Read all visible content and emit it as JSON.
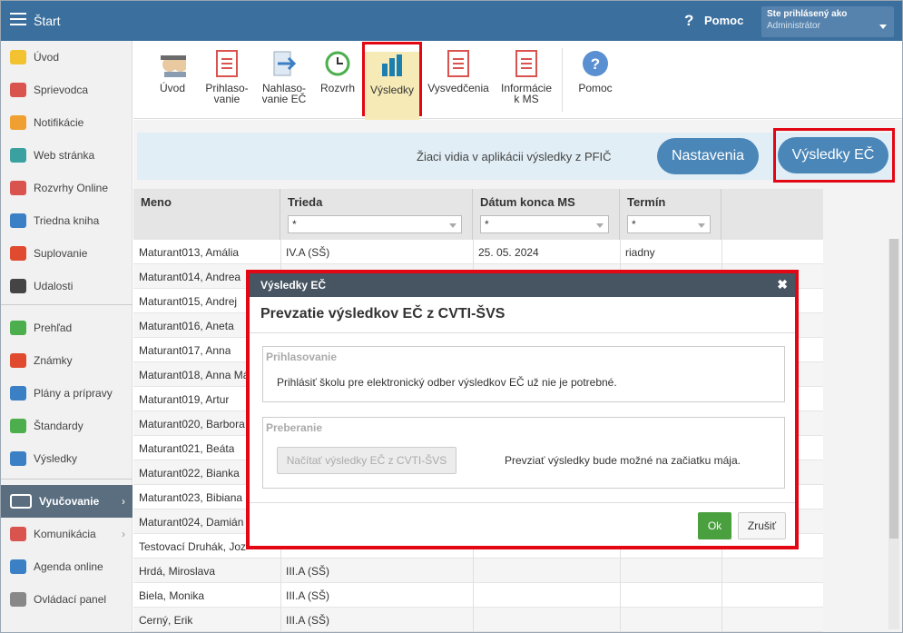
{
  "topbar": {
    "title": "Štart",
    "help_q": "?",
    "help": "Pomoc",
    "user_label": "Ste prihlásený ako",
    "user_name": "Administrátor"
  },
  "sidebar": {
    "items": [
      {
        "label": "Úvod",
        "icon": "star-icon",
        "color": "#f2c230"
      },
      {
        "label": "Sprievodca",
        "icon": "magic-wand-icon",
        "color": "#d9534f"
      },
      {
        "label": "Notifikácie",
        "icon": "envelope-icon",
        "color": "#f0a030"
      },
      {
        "label": "Web stránka",
        "icon": "house-icon",
        "color": "#3aa0a0"
      },
      {
        "label": "Rozvrhy Online",
        "icon": "grid-calendar-icon",
        "color": "#d9534f"
      },
      {
        "label": "Triedna kniha",
        "icon": "book-icon",
        "color": "#3b7fc4"
      },
      {
        "label": "Suplovanie",
        "icon": "person-icon",
        "color": "#e04a2f"
      },
      {
        "label": "Udalosti",
        "icon": "calendar-icon",
        "color": "#444444"
      },
      {
        "label": "Prehľad",
        "icon": "check-circle-icon",
        "color": "#4cae4c"
      },
      {
        "label": "Známky",
        "icon": "pin-icon",
        "color": "#e04a2f"
      },
      {
        "label": "Plány a prípravy",
        "icon": "briefcase-icon",
        "color": "#3b7fc4"
      },
      {
        "label": "Štandardy",
        "icon": "shield-check-icon",
        "color": "#4cae4c"
      },
      {
        "label": "Výsledky",
        "icon": "bar-chart-icon",
        "color": "#3b7fc4"
      },
      {
        "label": "Vyučovanie",
        "icon": "open-book-icon",
        "color": "#ffffff"
      },
      {
        "label": "Komunikácia",
        "icon": "chat-icon",
        "color": "#d9534f"
      },
      {
        "label": "Agenda online",
        "icon": "pencil-icon",
        "color": "#3b7fc4"
      },
      {
        "label": "Ovládací panel",
        "icon": "gear-icon",
        "color": "#888888"
      }
    ]
  },
  "toolbar": {
    "buttons": [
      {
        "label": "Úvod",
        "icon": "students-icon"
      },
      {
        "label": "Prihlaso-\nvanie",
        "icon": "form-document-icon"
      },
      {
        "label": "Nahlaso-\nvanie EČ",
        "icon": "export-arrow-icon"
      },
      {
        "label": "Rozvrh",
        "icon": "clock-icon"
      },
      {
        "label": "Výsledky",
        "icon": "bar-chart-icon"
      },
      {
        "label": "Vysvedčenia",
        "icon": "certificate-icon"
      },
      {
        "label": "Informácie\nk MS",
        "icon": "info-document-icon"
      },
      {
        "label": "Pomoc",
        "icon": "help-circle-icon"
      }
    ]
  },
  "banner": {
    "text": "Žiaci vidia v aplikácii výsledky z PFIČ",
    "settings": "Nastavenia",
    "results": "Výsledky EČ"
  },
  "table": {
    "columns": [
      "Meno",
      "Trieda",
      "Dátum konca MS",
      "Termín"
    ],
    "filter_value": "*",
    "rows": [
      {
        "meno": "Maturant013, Amália",
        "trieda": "IV.A (SŠ)",
        "datum": "25. 05. 2024",
        "termin": "riadny"
      },
      {
        "meno": "Maturant014, Andrea",
        "trieda": "",
        "datum": "",
        "termin": ""
      },
      {
        "meno": "Maturant015, Andrej",
        "trieda": "",
        "datum": "",
        "termin": ""
      },
      {
        "meno": "Maturant016, Aneta",
        "trieda": "",
        "datum": "",
        "termin": ""
      },
      {
        "meno": "Maturant017, Anna",
        "trieda": "",
        "datum": "",
        "termin": ""
      },
      {
        "meno": "Maturant018, Anna Má",
        "trieda": "",
        "datum": "",
        "termin": ""
      },
      {
        "meno": "Maturant019, Artur",
        "trieda": "",
        "datum": "",
        "termin": ""
      },
      {
        "meno": "Maturant020, Barbora",
        "trieda": "",
        "datum": "",
        "termin": ""
      },
      {
        "meno": "Maturant021, Beáta",
        "trieda": "",
        "datum": "",
        "termin": ""
      },
      {
        "meno": "Maturant022, Bianka",
        "trieda": "",
        "datum": "",
        "termin": ""
      },
      {
        "meno": "Maturant023, Bibiana",
        "trieda": "",
        "datum": "",
        "termin": ""
      },
      {
        "meno": "Maturant024, Damián",
        "trieda": "",
        "datum": "",
        "termin": ""
      },
      {
        "meno": "Testovací Druhák, Joz",
        "trieda": "",
        "datum": "",
        "termin": ""
      },
      {
        "meno": "Hrdá, Miroslava",
        "trieda": "III.A (SŠ)",
        "datum": "",
        "termin": ""
      },
      {
        "meno": "Biela, Monika",
        "trieda": "III.A (SŠ)",
        "datum": "",
        "termin": ""
      },
      {
        "meno": "Cerný, Erik",
        "trieda": "III.A (SŠ)",
        "datum": "",
        "termin": ""
      }
    ]
  },
  "modal": {
    "header": "Výsledky EČ",
    "close": "✖",
    "title": "Prevzatie výsledkov EČ z CVTI-ŠVS",
    "section1_legend": "Prihlasovanie",
    "section1_text": "Prihlásiť školu pre elektronický odber výsledkov EČ už nie je potrebné.",
    "section2_legend": "Preberanie",
    "load_button": "Načítať výsledky EČ z CVTI-ŠVS",
    "section2_text": "Prevziať výsledky bude možné na začiatku mája.",
    "ok": "Ok",
    "cancel": "Zrušiť"
  }
}
